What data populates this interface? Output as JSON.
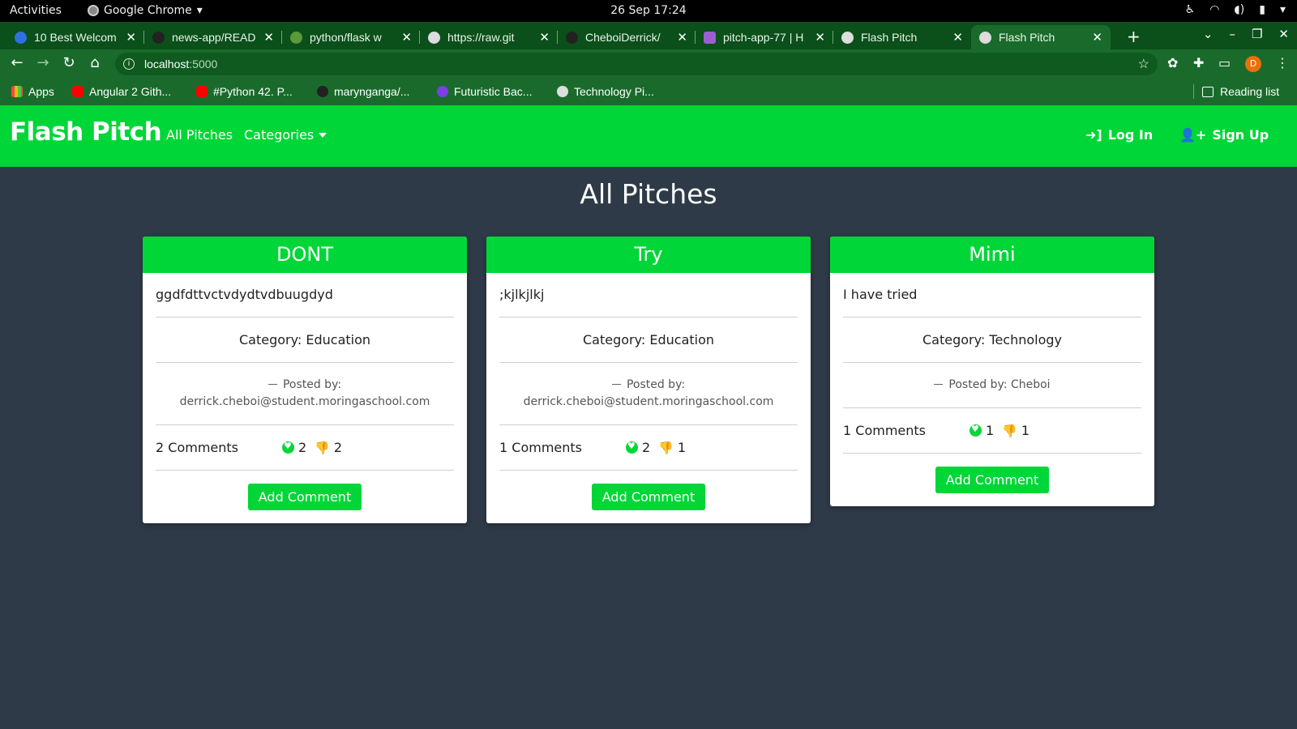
{
  "os": {
    "activities": "Activities",
    "app_name": "Google Chrome",
    "clock": "26 Sep  17:24"
  },
  "tabs": [
    {
      "title": "10 Best Welcom"
    },
    {
      "title": "news-app/READ"
    },
    {
      "title": "python/flask w"
    },
    {
      "title": "https://raw.git"
    },
    {
      "title": "CheboiDerrick/"
    },
    {
      "title": "pitch-app-77 | H"
    },
    {
      "title": "Flash Pitch"
    },
    {
      "title": "Flash Pitch",
      "active": true
    }
  ],
  "address_bar": {
    "host": "localhost",
    "port": ":5000"
  },
  "profile_initial": "D",
  "bookmarks": [
    {
      "label": "Apps",
      "icon": "apps-grid-icon"
    },
    {
      "label": "Angular 2 Gith...",
      "icon": "youtube-icon"
    },
    {
      "label": "#Python 42. P...",
      "icon": "youtube-icon"
    },
    {
      "label": "maryng​anga/...",
      "icon": "github-icon"
    },
    {
      "label": "Futuristic Bac...",
      "icon": "futuristic-icon"
    },
    {
      "label": "Technology Pi...",
      "icon": "globe-icon"
    }
  ],
  "reading_list": "Reading list",
  "site": {
    "brand": "Flash Pitch",
    "nav": {
      "all_pitches": "All Pitches",
      "categories": "Categories"
    },
    "login": "Log In",
    "signup": "Sign Up",
    "page_title": "All Pitches",
    "accent": "#00d637",
    "background": "#2e3a47"
  },
  "pitches": [
    {
      "title": "DONT",
      "description": "ggdfdttvctvdydtvdbuugdyd",
      "category": "Category: Education",
      "posted_label": "Posted by:",
      "author": "derrick.cheboi@student.moringaschool.com",
      "comments": "2 Comments",
      "likes": "2",
      "dislikes": "2",
      "button": "Add Comment"
    },
    {
      "title": "Try",
      "description": ";kjlkjlkj",
      "category": "Category: Education",
      "posted_label": "Posted by:",
      "author": "derrick.cheboi@student.moringaschool.com",
      "comments": "1 Comments",
      "likes": "2",
      "dislikes": "1",
      "button": "Add Comment"
    },
    {
      "title": "Mimi",
      "description": "I have tried",
      "category": "Category: Technology",
      "posted_label": "Posted by: Cheboi",
      "author": "",
      "comments": "1 Comments",
      "likes": "1",
      "dislikes": "1",
      "button": "Add Comment"
    }
  ]
}
